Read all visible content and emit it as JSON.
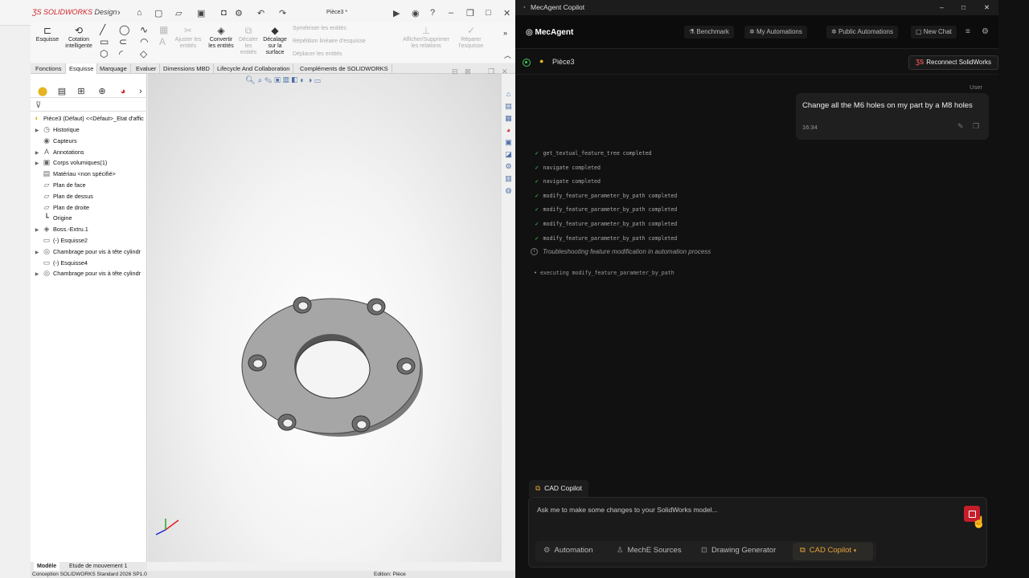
{
  "solidworks": {
    "logo_brand": "SOLIDWORKS",
    "logo_edition": "Design",
    "document_title": "Pièce3 *",
    "ribbon": {
      "sketch": "Esquisse",
      "smart_dim_1": "Cotation",
      "smart_dim_2": "intelligente",
      "trim_1": "Ajuster les",
      "trim_2": "entités",
      "convert_1": "Convertir",
      "convert_2": "les entités",
      "offset_1": "Décaler",
      "offset_2": "les",
      "offset_3": "entités",
      "offset_surf_1": "Décalage",
      "offset_surf_2": "sur la",
      "offset_surf_3": "surface",
      "mirror": "Symétriser les entités",
      "linear_pattern": "Répétition linéaire d'esquisse",
      "move": "Déplacer les entités",
      "relations_1": "Afficher/Supprimer",
      "relations_2": "les relations",
      "repair_1": "Réparer",
      "repair_2": "l'esquisse"
    },
    "tabs": [
      "Fonctions",
      "Esquisse",
      "Marquage",
      "Evaluer",
      "Dimensions MBD",
      "Lifecycle And Collaboration",
      "Compléments de SOLIDWORKS"
    ],
    "active_tab": "Esquisse",
    "tree": {
      "root": "Pièce3 (Défaut) <<Défaut>_Etat d'affic",
      "items": [
        {
          "label": "Historique",
          "icon": "history-icon"
        },
        {
          "label": "Capteurs",
          "icon": "sensor-icon"
        },
        {
          "label": "Annotations",
          "icon": "annotation-icon"
        },
        {
          "label": "Corps volumiques(1)",
          "icon": "solid-bodies-icon"
        },
        {
          "label": "Matériau <non spécifié>",
          "icon": "material-icon"
        },
        {
          "label": "Plan de face",
          "icon": "plane-icon"
        },
        {
          "label": "Plan de dessus",
          "icon": "plane-icon"
        },
        {
          "label": "Plan de droite",
          "icon": "plane-icon"
        },
        {
          "label": "Origine",
          "icon": "origin-icon"
        },
        {
          "label": "Boss.-Extru.1",
          "icon": "extrude-icon"
        },
        {
          "label": "(-) Esquisse2",
          "icon": "sketch-icon"
        },
        {
          "label": "Chambrage pour vis à tête cylindr",
          "icon": "hole-wizard-icon"
        },
        {
          "label": "(-) Esquisse4",
          "icon": "sketch-icon"
        },
        {
          "label": "Chambrage pour vis à tête cylindr",
          "icon": "hole-wizard-icon"
        }
      ]
    },
    "bottom_tabs": [
      "Modèle",
      "Etude de mouvement 1"
    ],
    "status_left": "Conception SOLIDWORKS Standard 2026 SP1.0",
    "status_mid": "Edition: Pièce"
  },
  "copilot": {
    "window_title": "MecAgent Copilot",
    "brand": "MecAgent",
    "nav": {
      "benchmark": "Benchmark",
      "my_automations": "My Automations",
      "public_automations": "Public Automations",
      "new_chat": "New Chat"
    },
    "context_part": "Pièce3",
    "reconnect_label": "Reconnect SolidWorks",
    "user_label": "User",
    "user_message": "Change all the M6 holes on my part by a M8 holes",
    "message_time": "16:34",
    "tool_log": [
      "get_textual_feature_tree completed",
      "navigate completed",
      "navigate completed",
      "modify_feature_parameter_by_path completed",
      "modify_feature_parameter_by_path completed",
      "modify_feature_parameter_by_path completed",
      "modify_feature_parameter_by_path completed"
    ],
    "troubleshoot": "Troubleshooting feature modification in automation process",
    "executing": "executing modify_feature_parameter_by_path",
    "mode_chip": "CAD Copilot",
    "input_placeholder": "Ask me to make some changes to your SolidWorks model...",
    "modes": [
      "Automation",
      "MechE Sources",
      "Drawing Generator",
      "CAD Copilot"
    ],
    "active_mode": "CAD Copilot",
    "accent_color": "#e6a33a",
    "success_color": "#3ecf5c",
    "stop_color": "#c41e2a"
  }
}
